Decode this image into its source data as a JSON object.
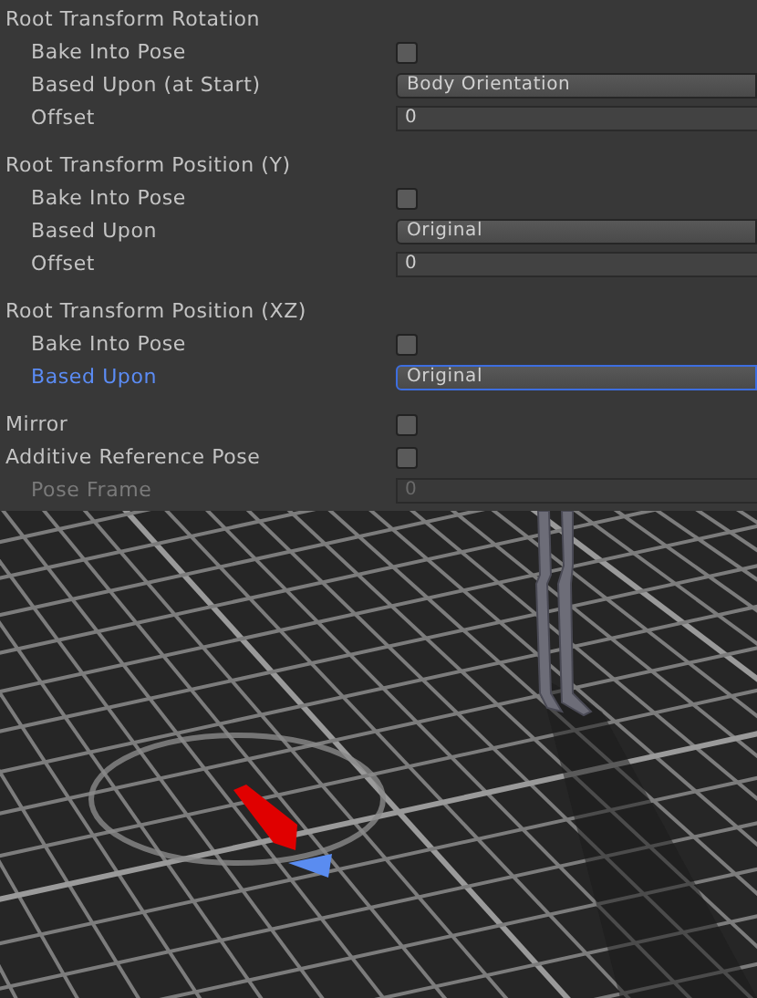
{
  "properties": [
    {
      "kind": "group",
      "label": "Root Transform Rotation",
      "children": [
        {
          "kind": "checkbox",
          "label": "Bake Into Pose",
          "checked": false,
          "focused": false,
          "disabled": false
        },
        {
          "kind": "dropdown",
          "label": "Based Upon (at Start)",
          "value": "Body Orientation",
          "focused": false,
          "disabled": false
        },
        {
          "kind": "number",
          "label": "Offset",
          "value": "0",
          "focused": false,
          "disabled": false
        }
      ]
    },
    {
      "kind": "group",
      "label": "Root Transform Position (Y)",
      "children": [
        {
          "kind": "checkbox",
          "label": "Bake Into Pose",
          "checked": false,
          "focused": false,
          "disabled": false
        },
        {
          "kind": "dropdown",
          "label": "Based Upon",
          "value": "Original",
          "focused": false,
          "disabled": false
        },
        {
          "kind": "number",
          "label": "Offset",
          "value": "0",
          "focused": false,
          "disabled": false
        }
      ]
    },
    {
      "kind": "group",
      "label": "Root Transform Position (XZ)",
      "children": [
        {
          "kind": "checkbox",
          "label": "Bake Into Pose",
          "checked": false,
          "focused": false,
          "disabled": false
        },
        {
          "kind": "dropdown",
          "label": "Based Upon",
          "value": "Original",
          "focused": true,
          "disabled": false
        }
      ]
    },
    {
      "kind": "checkbox",
      "label": "Mirror",
      "checked": false,
      "focused": false,
      "disabled": false
    },
    {
      "kind": "checkbox",
      "label": "Additive Reference Pose",
      "checked": false,
      "focused": false,
      "disabled": false,
      "children": [
        {
          "kind": "number",
          "label": "Pose Frame",
          "value": "0",
          "focused": false,
          "disabled": true
        }
      ]
    }
  ]
}
